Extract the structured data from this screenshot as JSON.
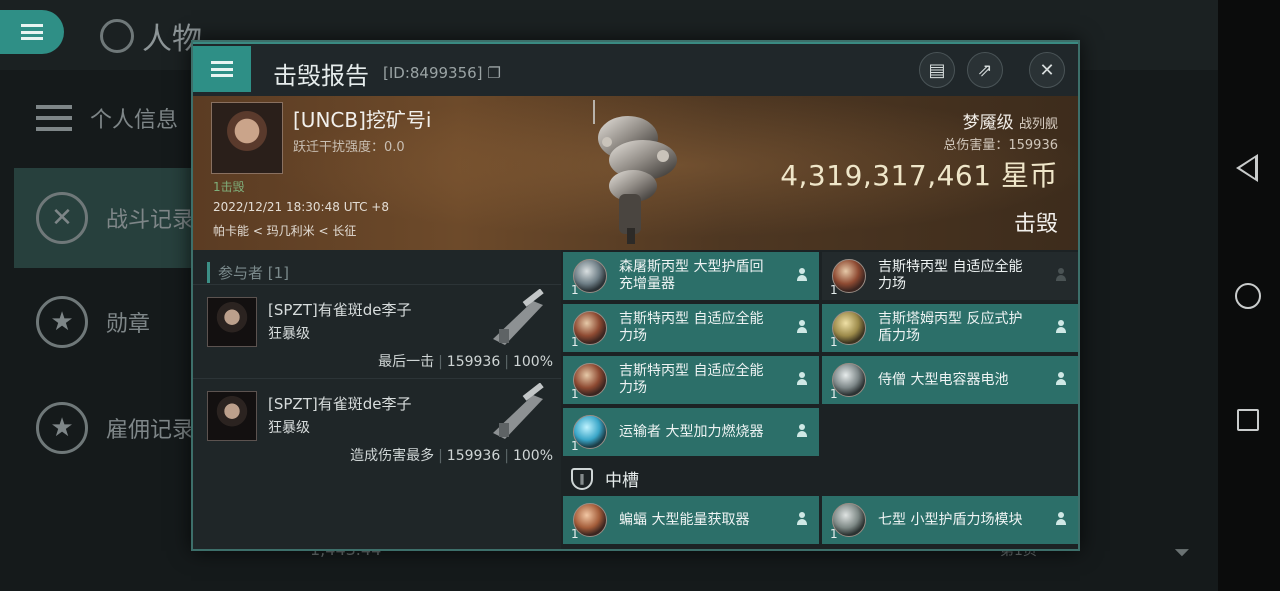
{
  "background": {
    "title": "人物",
    "sidebar": [
      {
        "label": "个人信息",
        "icon": "list-icon"
      },
      {
        "label": "战斗记录",
        "icon": "crossed-swords-icon"
      },
      {
        "label": "勋章",
        "icon": "star-medal-icon"
      },
      {
        "label": "雇佣记录",
        "icon": "star-laurel-icon"
      }
    ],
    "bottom_value": "1,443.44",
    "bottom_page": "第1页"
  },
  "dialog": {
    "title": "击毁报告",
    "id_text": "[ID:8499356]",
    "victim": {
      "name": "[UNCB]挖矿号i",
      "warp_disrupt": "跃迁干扰强度：0.0",
      "kills": "1击毁",
      "time": "2022/12/21 18:30:48 UTC +8",
      "location": "帕卡能 < 玛几利米 < 长征",
      "ship_class": "梦魇级",
      "ship_type": "战列舰",
      "total_damage_label": "总伤害量：159936",
      "isk_value": "4,319,317,461",
      "isk_unit": "星币",
      "status": "击毁"
    },
    "participants_title": "参与者 [1]",
    "attackers": [
      {
        "name": "[SPZT]有雀斑de李子",
        "ship": "狂暴级",
        "tag": "最后一击",
        "damage": "159936",
        "percent": "100%"
      },
      {
        "name": "[SPZT]有雀斑de李子",
        "ship": "狂暴级",
        "tag": "造成伤害最多",
        "damage": "159936",
        "percent": "100%"
      }
    ],
    "modules_left": [
      {
        "name": "森屠斯丙型 大型护盾回充增量器",
        "qty": "1",
        "icon": "shield-recharger-icon",
        "style": "shield1",
        "dropped": true
      },
      {
        "name": "吉斯特丙型 自适应全能力场",
        "qty": "1",
        "icon": "adaptive-field-icon",
        "style": "",
        "dropped": true
      },
      {
        "name": "吉斯特丙型 自适应全能力场",
        "qty": "1",
        "icon": "adaptive-field-icon",
        "style": "",
        "dropped": true
      },
      {
        "name": "运输者 大型加力燃烧器",
        "qty": "1",
        "icon": "afterburner-icon",
        "style": "ab",
        "dropped": true
      }
    ],
    "modules_right": [
      {
        "name": "吉斯特丙型 自适应全能力场",
        "qty": "1",
        "icon": "adaptive-field-icon",
        "style": "",
        "dropped": false
      },
      {
        "name": "吉斯塔姆丙型 反应式护盾力场",
        "qty": "1",
        "icon": "reactive-shield-icon",
        "style": "shield2",
        "dropped": true
      },
      {
        "name": "侍僧 大型电容器电池",
        "qty": "1",
        "icon": "capacitor-battery-icon",
        "style": "battery",
        "dropped": true
      }
    ],
    "mid_slot_label": "中槽",
    "mid_modules": [
      {
        "name": "蝙蝠 大型能量获取器",
        "qty": "1",
        "icon": "energy-nosferatu-icon",
        "style": "nos",
        "dropped": true
      },
      {
        "name": "七型 小型护盾力场模块",
        "qty": "1",
        "icon": "small-shield-icon",
        "style": "small",
        "dropped": true
      }
    ]
  }
}
